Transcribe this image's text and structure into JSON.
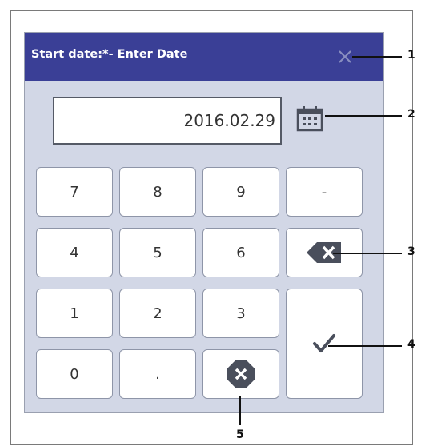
{
  "dialog": {
    "title": "Start date:*- Enter Date",
    "date_value": "2016.02.29"
  },
  "keypad": {
    "row1": [
      "7",
      "8",
      "9",
      "-"
    ],
    "row2": [
      "4",
      "5",
      "6"
    ],
    "row3": [
      "1",
      "2",
      "3"
    ],
    "row4": [
      "0",
      "."
    ]
  },
  "icons": {
    "close": "close-icon",
    "calendar": "calendar-icon",
    "backspace": "backspace-icon",
    "confirm": "checkmark-icon",
    "clear": "clear-icon"
  },
  "callouts": [
    "1",
    "2",
    "3",
    "4",
    "5"
  ],
  "colors": {
    "header": "#3a3f96",
    "dialog_bg": "#d2d7e6",
    "key_bg": "#ffffff",
    "icon_dark": "#4a4f5c"
  }
}
